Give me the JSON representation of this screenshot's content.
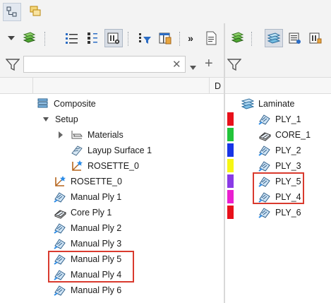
{
  "left_panel": {
    "column_header": "D",
    "filter": {
      "value": "",
      "placeholder": ""
    },
    "tree": [
      {
        "label": "Composite",
        "icon": "composite-icon"
      },
      {
        "label": "Setup",
        "icon": ""
      },
      {
        "label": "Materials",
        "icon": "materials-folder-icon"
      },
      {
        "label": "Layup Surface 1",
        "icon": "layup-surface-icon"
      },
      {
        "label": "ROSETTE_0",
        "icon": "rosette-icon"
      },
      {
        "label": "ROSETTE_0",
        "icon": "rosette-icon"
      },
      {
        "label": "Manual Ply 1",
        "icon": "manual-ply-icon"
      },
      {
        "label": "Core Ply 1",
        "icon": "core-ply-icon"
      },
      {
        "label": "Manual Ply 2",
        "icon": "manual-ply-icon"
      },
      {
        "label": "Manual Ply 3",
        "icon": "manual-ply-icon"
      },
      {
        "label": "Manual Ply 5",
        "icon": "manual-ply-icon"
      },
      {
        "label": "Manual Ply 4",
        "icon": "manual-ply-icon"
      },
      {
        "label": "Manual Ply 6",
        "icon": "manual-ply-icon"
      }
    ]
  },
  "right_panel": {
    "root": {
      "label": "Laminate",
      "icon": "laminate-icon"
    },
    "plies": [
      {
        "label": "PLY_1",
        "color": "#e8101a",
        "icon": "ply-icon"
      },
      {
        "label": "CORE_1",
        "color": "#22c43a",
        "icon": "core-icon"
      },
      {
        "label": "PLY_2",
        "color": "#1835e6",
        "icon": "ply-icon"
      },
      {
        "label": "PLY_3",
        "color": "#f6f614",
        "icon": "ply-icon"
      },
      {
        "label": "PLY_5",
        "color": "#8a3ae6",
        "icon": "ply-icon"
      },
      {
        "label": "PLY_4",
        "color": "#ea1fd0",
        "icon": "ply-icon"
      },
      {
        "label": "PLY_6",
        "color": "#e8101a",
        "icon": "ply-icon"
      }
    ]
  },
  "icons": {
    "tabs": [
      "model-tree-icon",
      "layer-tree-icon"
    ],
    "left_toolbar": [
      "dropdown-arrow-icon",
      "layer-stack-icon",
      "list-view-icon",
      "tree-view-icon",
      "show-tree-icon",
      "tree-filter-icon",
      "tree-columns-icon",
      "more-icon",
      "document-icon"
    ],
    "right_toolbar": [
      "layer-stack-icon",
      "laminate-view-icon",
      "table-view-icon",
      "settings-icon"
    ],
    "filter": [
      "filter-icon",
      "clear-icon",
      "dropdown-arrow-icon",
      "add-icon"
    ],
    "highlight_color": "#d93a2e"
  }
}
